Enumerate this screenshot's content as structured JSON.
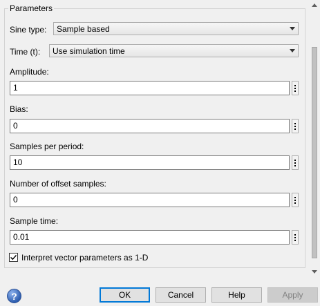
{
  "parameters": {
    "group_title": "Parameters",
    "sine_type": {
      "label": "Sine type:",
      "value": "Sample based"
    },
    "time": {
      "label": "Time (t):",
      "value": "Use simulation time"
    },
    "amplitude": {
      "label": "Amplitude:",
      "value": "1"
    },
    "bias": {
      "label": "Bias:",
      "value": "0"
    },
    "samples_per_period": {
      "label": "Samples per period:",
      "value": "10"
    },
    "offset_samples": {
      "label": "Number of offset samples:",
      "value": "0"
    },
    "sample_time": {
      "label": "Sample time:",
      "value": "0.01"
    },
    "interpret_vector": {
      "label": "Interpret vector parameters as 1-D",
      "checked": true
    }
  },
  "buttons": {
    "ok": "OK",
    "cancel": "Cancel",
    "help": "Help",
    "apply": "Apply"
  },
  "icons": {
    "help": "help-question-icon",
    "dropdown": "chevron-down-icon",
    "more_options": "vertical-ellipsis-icon",
    "check": "checkmark-icon"
  },
  "colors": {
    "default_button_border": "#0078d7",
    "dialog_background": "#f0f0f0"
  }
}
